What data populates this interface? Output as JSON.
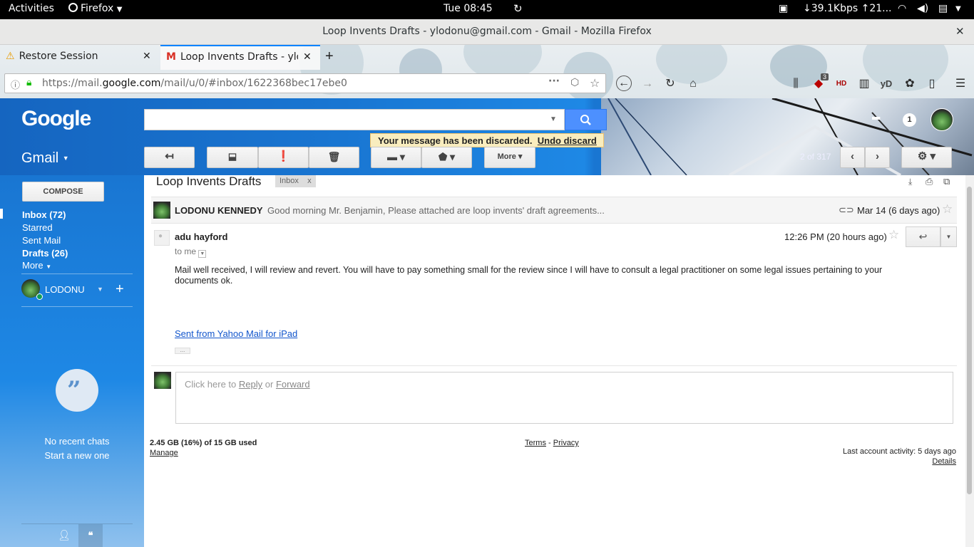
{
  "topbar": {
    "activities": "Activities",
    "app": "Firefox",
    "clock": "Tue 08:45",
    "network": "↓39.1Kbps ↑21..."
  },
  "window": {
    "title": "Loop Invents Drafts - ylodonu@gmail.com - Gmail - Mozilla Firefox"
  },
  "tabs": [
    {
      "label": "Restore Session",
      "icon": "warning-icon"
    },
    {
      "label": "Loop Invents Drafts - ylodonu",
      "icon": "gmail-icon"
    }
  ],
  "url": {
    "prefix": "https://mail.",
    "domain": "google.com",
    "path": "/mail/u/0/#inbox/1622368bec17ebe0"
  },
  "toolbar_badge": "3",
  "gmail": {
    "logo": "Google",
    "app_label": "Gmail",
    "notifications_count": "1",
    "notice": "Your message has been discarded.",
    "undo": "Undo discard",
    "more_button": "More",
    "pagination": "2 of 317"
  },
  "sidebar": {
    "compose": "COMPOSE",
    "items": [
      {
        "label": "Inbox (72)",
        "bold": true
      },
      {
        "label": "Starred",
        "bold": false
      },
      {
        "label": "Sent Mail",
        "bold": false
      },
      {
        "label": "Drafts (26)",
        "bold": true
      },
      {
        "label": "More",
        "bold": false
      }
    ],
    "account": "LODONU",
    "no_chats": "No recent chats",
    "start_new": "Start a new one"
  },
  "thread": {
    "subject": "Loop Invents Drafts",
    "label": "Inbox",
    "label_close": "x",
    "collapsed": {
      "sender": "LODONU KENNEDY",
      "snippet": "Good morning Mr. Benjamin, Please attached are loop invents' draft agreements...",
      "date": "Mar 14 (6 days ago)"
    },
    "message": {
      "sender": "adu hayford",
      "to": "to me",
      "date": "12:26 PM (20 hours ago)",
      "body_line1": "Mail well received, I will review and revert. You will have to pay something small for the review since I will have to consult a legal practitioner on some legal issues pertaining to your",
      "body_line2": "documents ok.",
      "signature": "Sent from Yahoo Mail for iPad",
      "ellipsis": "..."
    },
    "reply": {
      "prefix": "Click here to",
      "reply": "Reply",
      "or": "or",
      "forward": "Forward"
    }
  },
  "footer": {
    "storage": "2.45 GB (16%) of 15 GB used",
    "manage": "Manage",
    "terms": "Terms",
    "dash": "-",
    "privacy": "Privacy",
    "activity": "Last account activity: 5 days ago",
    "details": "Details"
  },
  "colors": {
    "gmail_blue": "#1976d2",
    "search_blue": "#4d90fe",
    "link": "#1155cc",
    "notice_bg": "#f9edbe"
  }
}
